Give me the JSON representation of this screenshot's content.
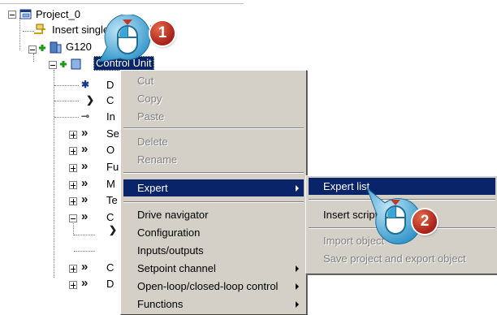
{
  "tree": {
    "project": "Project_0",
    "insert_unit": "Insert single drive unit",
    "drive_unit": "G120",
    "control_unit": "Control Unit",
    "children": [
      {
        "letter": "D"
      },
      {
        "letter": "C"
      },
      {
        "letter": "In"
      },
      {
        "letter": "Se"
      },
      {
        "letter": "O"
      },
      {
        "letter": "Fu"
      },
      {
        "letter": "M"
      },
      {
        "letter": "Te"
      },
      {
        "letter": "C"
      },
      {
        "letter": "C"
      },
      {
        "letter": "D"
      }
    ]
  },
  "context_menu": {
    "items": [
      {
        "label": "Cut",
        "enabled": false
      },
      {
        "label": "Copy",
        "enabled": false
      },
      {
        "label": "Paste",
        "enabled": false
      },
      {
        "label": "Delete",
        "enabled": false
      },
      {
        "label": "Rename",
        "enabled": false
      },
      {
        "label": "Expert",
        "enabled": true,
        "submenu": true,
        "highlighted": true
      },
      {
        "label": "Drive navigator",
        "enabled": true
      },
      {
        "label": "Configuration",
        "enabled": true
      },
      {
        "label": "Inputs/outputs",
        "enabled": true
      },
      {
        "label": "Setpoint channel",
        "enabled": true,
        "submenu": true
      },
      {
        "label": "Open-loop/closed-loop control",
        "enabled": true,
        "submenu": true
      },
      {
        "label": "Functions",
        "enabled": true,
        "submenu": true
      }
    ]
  },
  "submenu": {
    "items": [
      {
        "label": "Expert list",
        "enabled": true,
        "highlighted": true
      },
      {
        "label": "Insert script folder",
        "enabled": true
      },
      {
        "label": "Import object",
        "enabled": false
      },
      {
        "label": "Save project and export object",
        "enabled": false
      }
    ]
  },
  "callouts": {
    "step1": "1",
    "step2": "2"
  },
  "colors": {
    "selection": "#0a246a",
    "menu_bg": "#d4d0c8",
    "callout_red": "#b42a1e",
    "mouse_blue": "#3aa6d8"
  }
}
